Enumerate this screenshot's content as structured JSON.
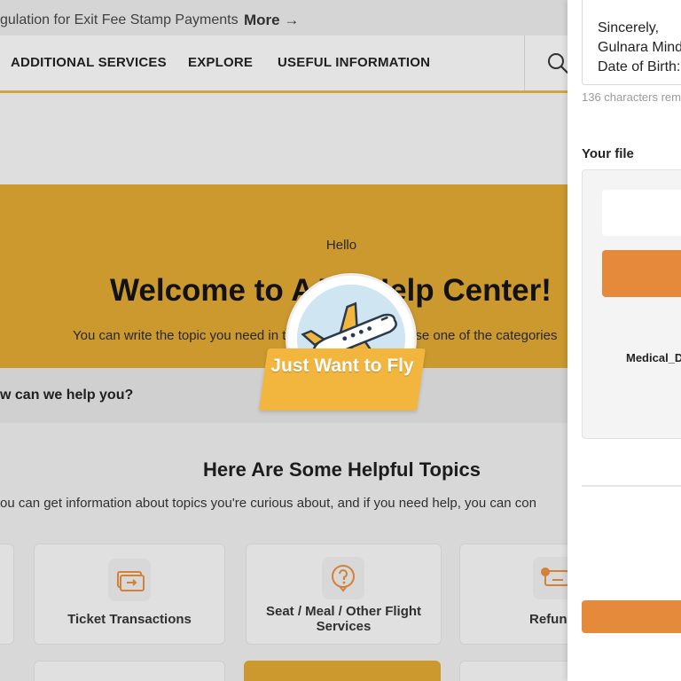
{
  "announcement": {
    "text": "gulation for Exit Fee Stamp Payments",
    "more_label": "More →"
  },
  "nav": {
    "items": [
      "ADDITIONAL SERVICES",
      "EXPLORE",
      "USEFUL INFORMATION"
    ],
    "search_icon": "search-icon"
  },
  "hero": {
    "greeting": "Hello",
    "title": "Welcome to AJet Help Center!",
    "subtitle": "You can write the topic you need in the search bar or choose one of the categories"
  },
  "search": {
    "text": "w can we help you?"
  },
  "topics": {
    "title": "Here Are Some Helpful Topics",
    "subtitle": "ou can get information about topics you're curious about, and if you need help, you can con",
    "cards": [
      {
        "label": "Ticket Transactions",
        "icon": "ticket-icon"
      },
      {
        "label": "Seat / Meal / Other Flight Services",
        "icon": "question-bubble-icon"
      },
      {
        "label": "Refun",
        "icon": "refund-icon"
      }
    ]
  },
  "sticker": {
    "text": "Just Want to Fly",
    "icon": "airplane-icon",
    "colors": {
      "banner": "#f2b63f",
      "sky": "#cfe6f2"
    }
  },
  "panel": {
    "letter_lines": [
      "Sincerely,",
      "Gulnara Mind",
      "Date of Birth:"
    ],
    "char_count": "136 characters rem",
    "file_title": "Your file",
    "file_name": "Medical_D",
    "accent_color": "#e58a3a"
  }
}
